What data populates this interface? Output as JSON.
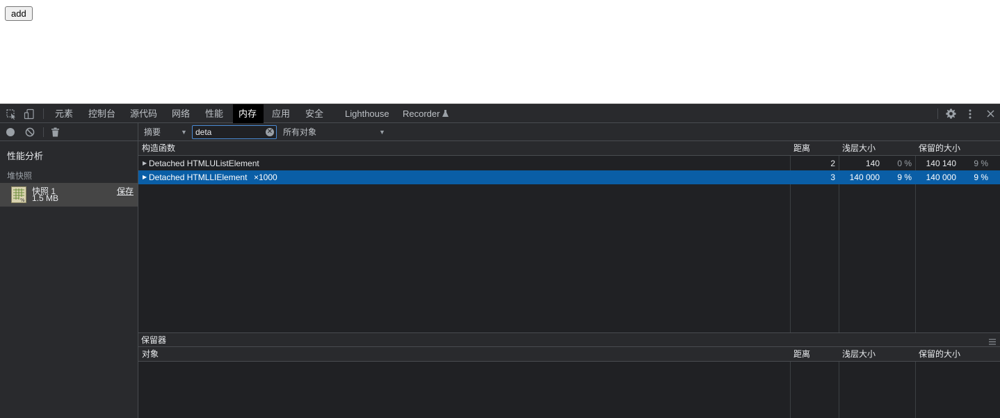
{
  "page": {
    "add_button": "add"
  },
  "devtools": {
    "tabs": [
      {
        "label": "元素"
      },
      {
        "label": "控制台"
      },
      {
        "label": "源代码"
      },
      {
        "label": "网络"
      },
      {
        "label": "性能"
      },
      {
        "label": "内存",
        "active": true
      },
      {
        "label": "应用"
      },
      {
        "label": "安全"
      },
      {
        "label": "Lighthouse"
      },
      {
        "label": "Recorder"
      }
    ],
    "sidebar": {
      "profiles_heading": "性能分析",
      "heap_snapshots_label": "堆快照",
      "snapshot": {
        "name": "快照 1",
        "size": "1.5 MB",
        "save_label": "保存"
      }
    },
    "toolbar": {
      "view_select": "摘要",
      "filter_value": "deta",
      "objects_select": "所有对象"
    },
    "table": {
      "headers": {
        "constructor": "构造函数",
        "distance": "距离",
        "shallow": "浅层大小",
        "retained": "保留的大小"
      },
      "rows": [
        {
          "name": "Detached HTMLUListElement",
          "count": "",
          "distance": "2",
          "shallow": "140",
          "shallow_pct": "0 %",
          "retained": "140 140",
          "retained_pct": "9 %",
          "selected": false
        },
        {
          "name": "Detached HTMLLIElement",
          "count": "×1000",
          "distance": "3",
          "shallow": "140 000",
          "shallow_pct": "9 %",
          "retained": "140 000",
          "retained_pct": "9 %",
          "selected": true
        }
      ]
    },
    "retainers": {
      "title": "保留器",
      "headers": {
        "object": "对象",
        "distance": "距离",
        "shallow": "浅层大小",
        "retained": "保留的大小"
      }
    }
  }
}
